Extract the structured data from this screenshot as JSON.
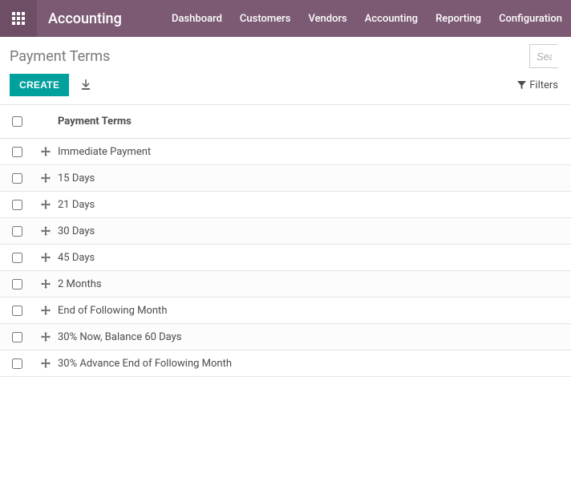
{
  "nav": {
    "brand": "Accounting",
    "items": [
      "Dashboard",
      "Customers",
      "Vendors",
      "Accounting",
      "Reporting",
      "Configuration"
    ]
  },
  "breadcrumb": {
    "title": "Payment Terms"
  },
  "search": {
    "placeholder": "Search..."
  },
  "controls": {
    "create_label": "CREATE",
    "filters_label": "Filters"
  },
  "table": {
    "header": "Payment Terms",
    "rows": [
      {
        "name": "Immediate Payment"
      },
      {
        "name": "15 Days"
      },
      {
        "name": "21 Days"
      },
      {
        "name": "30 Days"
      },
      {
        "name": "45 Days"
      },
      {
        "name": "2 Months"
      },
      {
        "name": "End of Following Month"
      },
      {
        "name": "30% Now, Balance 60 Days"
      },
      {
        "name": "30% Advance End of Following Month"
      }
    ]
  }
}
